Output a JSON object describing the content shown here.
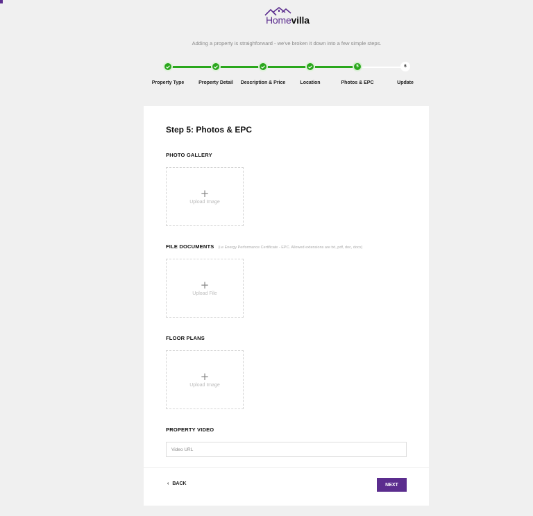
{
  "brand": {
    "logo_home": "Home",
    "logo_villa": "villa",
    "purple": "#5b2d8e",
    "green": "#2aa71c"
  },
  "tagline": "Adding a property is straighforward - we've broken it down into a few simple steps.",
  "stepper": {
    "steps": [
      {
        "label": "Property Type",
        "status": "done",
        "marker": "check-icon"
      },
      {
        "label": "Property Detail",
        "status": "done",
        "marker": "check-icon"
      },
      {
        "label": "Description & Price",
        "status": "done",
        "marker": "check-icon"
      },
      {
        "label": "Location",
        "status": "done",
        "marker": "check-icon"
      },
      {
        "label": "Photos & EPC",
        "status": "current",
        "number": "5"
      },
      {
        "label": "Update",
        "status": "todo",
        "number": "6"
      }
    ]
  },
  "form": {
    "title": "Step 5: Photos & EPC",
    "photo_gallery": {
      "heading": "PHOTO GALLERY",
      "upload_label": "Upload Image"
    },
    "file_documents": {
      "heading": "FILE DOCUMENTS",
      "note": "(i.e Energy Performance Certificate - EPC. Allowed extensions are txt, pdf, doc, docx)",
      "upload_label": "Upload File"
    },
    "floor_plans": {
      "heading": "FLOOR PLANS",
      "upload_label": "Upload Image"
    },
    "property_video": {
      "heading": "PROPERTY VIDEO",
      "placeholder": "Video URL",
      "value": ""
    },
    "upload_plus": "+"
  },
  "actions": {
    "back_arrow": "‹",
    "back_label": "BACK",
    "next_label": "NEXT"
  }
}
